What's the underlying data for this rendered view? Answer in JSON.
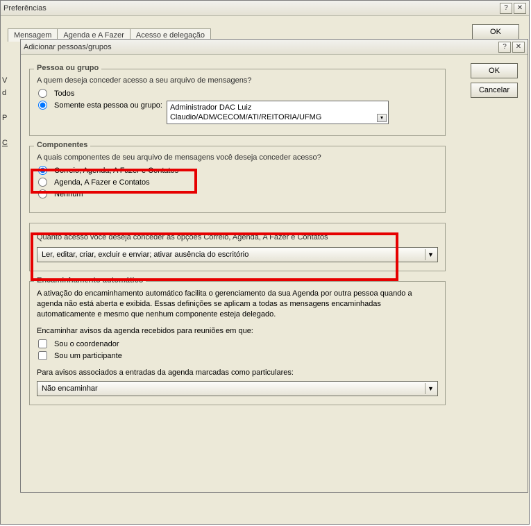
{
  "pref": {
    "title": "Preferências",
    "tabs": [
      "Mensagem",
      "Agenda e A Fazer",
      "Acesso e delegação"
    ],
    "ok": "OK"
  },
  "sliver": [
    "V",
    "d",
    "",
    "P",
    "",
    "C"
  ],
  "dlg": {
    "title": "Adicionar pessoas/grupos",
    "ok": "OK",
    "cancel": "Cancelar",
    "pessoa": {
      "legend": "Pessoa ou grupo",
      "q": "A quem deseja conceder acesso a seu arquivo de mensagens?",
      "opt_todos": "Todos",
      "opt_somente": "Somente esta pessoa ou grupo:",
      "value": "Administrador DAC Luiz Claudio/ADM/CECOM/ATI/REITORIA/UFMG"
    },
    "comp": {
      "legend": "Componentes",
      "q": "A quais componentes de seu arquivo de mensagens você deseja conceder acesso?",
      "opt1": "Correio, Agenda, A Fazer e Contatos",
      "opt2": "Agenda, A Fazer e Contatos",
      "opt3": "Nenhum"
    },
    "access": {
      "q": "Quanto acesso você deseja conceder às opções Correio, Agenda, A Fazer e Contatos",
      "value": "Ler, editar, criar, excluir e enviar; ativar ausência do escritório"
    },
    "enc": {
      "legend": "Encaminhamento automático",
      "p1": "A ativação do encaminhamento automático facilita o gerenciamento da sua Agenda por outra pessoa quando a agenda não está aberta e exibida. Essas definições se aplicam a todas as mensagens encaminhadas automaticamente e mesmo que nenhum componente esteja delegado.",
      "p2": "Encaminhar avisos da agenda recebidos para reuniões em que:",
      "cb1": "Sou o coordenador",
      "cb2": "Sou um participante",
      "p3": "Para avisos associados a entradas da agenda marcadas como particulares:",
      "combo": "Não encaminhar"
    }
  }
}
